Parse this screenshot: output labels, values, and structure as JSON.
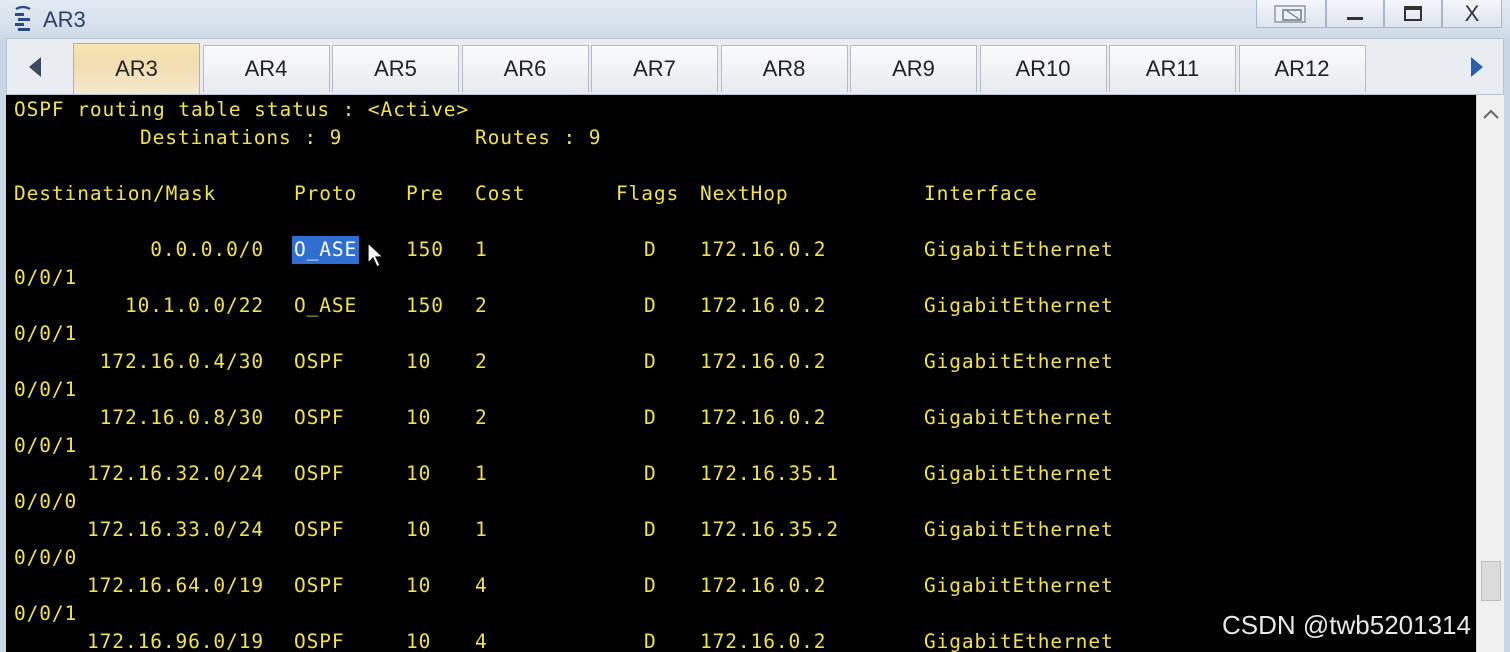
{
  "window": {
    "title": "AR3",
    "icon": "router-app-icon",
    "controls": {
      "restore": "restore-icon",
      "minimize": "minimize-icon",
      "maximize": "maximize-icon",
      "close": "X"
    }
  },
  "tabs": [
    {
      "label": "AR3",
      "active": true
    },
    {
      "label": "AR4"
    },
    {
      "label": "AR5"
    },
    {
      "label": "AR6"
    },
    {
      "label": "AR7"
    },
    {
      "label": "AR8"
    },
    {
      "label": "AR9"
    },
    {
      "label": "AR10"
    },
    {
      "label": "AR11"
    },
    {
      "label": "AR12"
    }
  ],
  "terminal": {
    "status_line": "OSPF routing table status : <Active>",
    "summary_destinations": "Destinations : 9",
    "summary_routes": "Routes : 9",
    "headers": {
      "dest": "Destination/Mask",
      "proto": "Proto",
      "pre": "Pre",
      "cost": "Cost",
      "flags": "Flags",
      "nexthop": "NextHop",
      "iface": "Interface"
    },
    "routes": [
      {
        "dest": "0.0.0.0/0",
        "proto": "O_ASE",
        "pre": "150",
        "cost": "1",
        "flags": "D",
        "nexthop": "172.16.0.2",
        "iface": "GigabitEthernet",
        "iface2": "0/0/1"
      },
      {
        "dest": "10.1.0.0/22",
        "proto": "O_ASE",
        "pre": "150",
        "cost": "2",
        "flags": "D",
        "nexthop": "172.16.0.2",
        "iface": "GigabitEthernet",
        "iface2": "0/0/1"
      },
      {
        "dest": "172.16.0.4/30",
        "proto": "OSPF",
        "pre": "10",
        "cost": "2",
        "flags": "D",
        "nexthop": "172.16.0.2",
        "iface": "GigabitEthernet",
        "iface2": "0/0/1"
      },
      {
        "dest": "172.16.0.8/30",
        "proto": "OSPF",
        "pre": "10",
        "cost": "2",
        "flags": "D",
        "nexthop": "172.16.0.2",
        "iface": "GigabitEthernet",
        "iface2": "0/0/1"
      },
      {
        "dest": "172.16.32.0/24",
        "proto": "OSPF",
        "pre": "10",
        "cost": "1",
        "flags": "D",
        "nexthop": "172.16.35.1",
        "iface": "GigabitEthernet",
        "iface2": "0/0/0"
      },
      {
        "dest": "172.16.33.0/24",
        "proto": "OSPF",
        "pre": "10",
        "cost": "1",
        "flags": "D",
        "nexthop": "172.16.35.2",
        "iface": "GigabitEthernet",
        "iface2": "0/0/0"
      },
      {
        "dest": "172.16.64.0/19",
        "proto": "OSPF",
        "pre": "10",
        "cost": "4",
        "flags": "D",
        "nexthop": "172.16.0.2",
        "iface": "GigabitEthernet",
        "iface2": "0/0/1"
      },
      {
        "dest": "172.16.96.0/19",
        "proto": "OSPF",
        "pre": "10",
        "cost": "4",
        "flags": "D",
        "nexthop": "172.16.0.2",
        "iface": "GigabitEthernet",
        "iface2": ""
      }
    ],
    "selected_text": "O_ASE",
    "text_color": "#f2e14a",
    "selection_color": "#2f6fd0"
  },
  "watermark": "CSDN @twb5201314"
}
